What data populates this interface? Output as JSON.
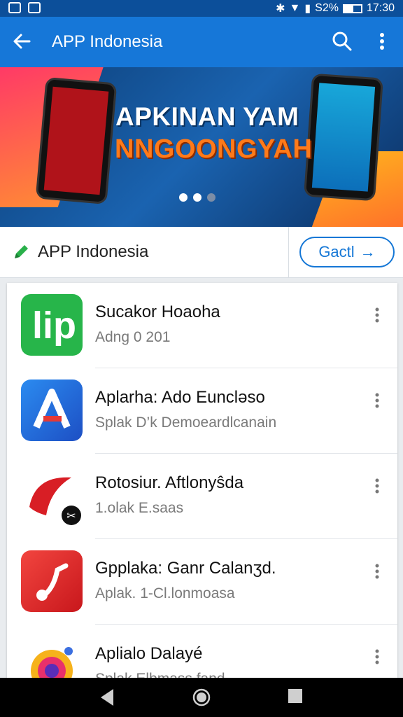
{
  "status_bar": {
    "signal_text": "S2%",
    "time": "17:30"
  },
  "app_bar": {
    "title": "APP Indonesia"
  },
  "banner": {
    "line1": "APKINAN YAM",
    "line2": "NNGOONGYAH",
    "active_slide": 2,
    "total_slides": 3
  },
  "section": {
    "title": "APP Indonesia",
    "button_label": "Gactl"
  },
  "apps": [
    {
      "title": "Sucakor Hoaoha",
      "subtitle": "Adng 0 201",
      "icon": "lip-app-icon",
      "color": "#27b54a"
    },
    {
      "title": "Aplarha: Ado Euncləso",
      "subtitle": "Splak D’k Demoeardlcanain",
      "icon": "a-logo-app-icon",
      "color": "#1f6fe0"
    },
    {
      "title": "Rotosiur. Aftlonyŝda",
      "subtitle": "1.olak E.saas",
      "icon": "red-swoosh-app-icon",
      "color": "#d81e25"
    },
    {
      "title": "Gpplaka: Ganr Calanʒd.",
      "subtitle": "Aplak. 1-Cl.lonmoasa",
      "icon": "music-note-app-icon",
      "color": "#e5302c"
    },
    {
      "title": "Aplialo Dalayé",
      "subtitle": "Splak Elbmass fand",
      "icon": "colorful-gear-app-icon",
      "color": "#f29a1b"
    }
  ]
}
